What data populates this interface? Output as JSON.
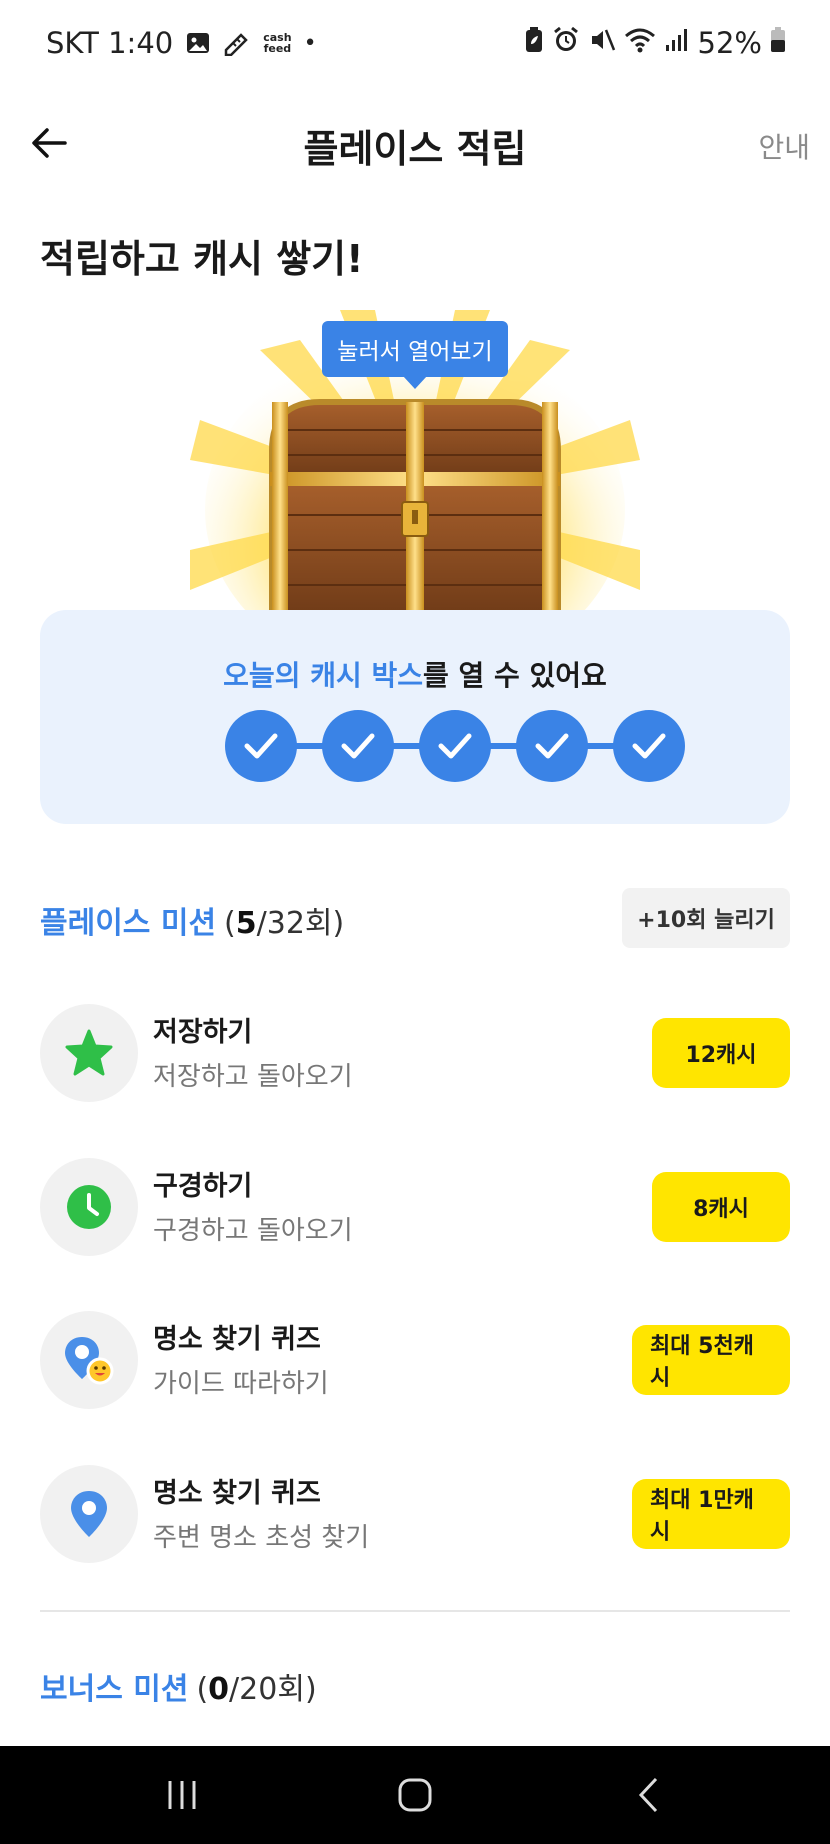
{
  "status": {
    "carrier_time": "SKT 1:40",
    "app_badge_top": "cash",
    "app_badge_bottom": "feed",
    "battery": "52%"
  },
  "header": {
    "title": "플레이스 적립",
    "info": "안내"
  },
  "headline": "적립하고 캐시 쌓기!",
  "chest": {
    "tooltip": "눌러서 열어보기"
  },
  "stamp_card": {
    "highlight": "오늘의 캐시 박스",
    "rest": "를 열 수 있어요",
    "stamps_total": 5,
    "stamps_done": 5
  },
  "place_mission": {
    "name": "플레이스 미션",
    "done": "5",
    "total": "/32회",
    "open_paren": "(",
    "close_paren": ")",
    "more_button": "+10회 늘리기"
  },
  "missions": [
    {
      "title": "저장하기",
      "desc": "저장하고 돌아오기",
      "reward": "12캐시",
      "icon": "star-icon"
    },
    {
      "title": "구경하기",
      "desc": "구경하고 돌아오기",
      "reward": "8캐시",
      "icon": "clock-icon"
    },
    {
      "title": "명소 찾기 퀴즈",
      "desc": "가이드 따라하기",
      "reward": "최대 5천캐시",
      "icon": "map-pin-smile-icon"
    },
    {
      "title": "명소 찾기 퀴즈",
      "desc": "주변 명소 초성 찾기",
      "reward": "최대 1만캐시",
      "icon": "map-pin-icon"
    }
  ],
  "bonus_mission": {
    "name": "보너스 미션",
    "done": "0",
    "total": "/20회",
    "open_paren": "(",
    "close_paren": ")"
  },
  "colors": {
    "accent": "#3a83e6",
    "reward": "#ffe500",
    "card_bg": "#eaf2fd"
  }
}
